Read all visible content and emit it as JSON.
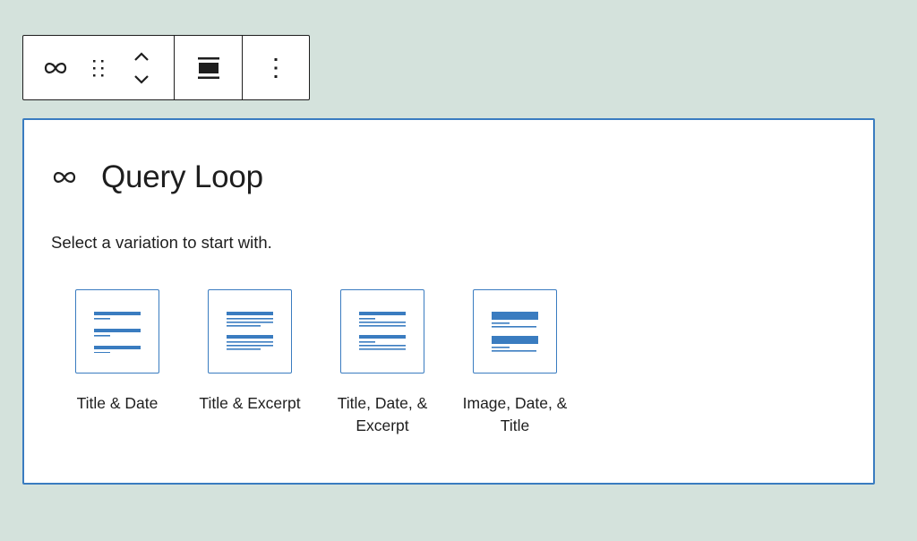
{
  "toolbar": {
    "groups": [
      {
        "buttons": [
          "query-loop-icon",
          "drag-handle-icon",
          "move-up-down-icon"
        ]
      },
      {
        "buttons": [
          "align-wide-icon"
        ]
      },
      {
        "buttons": [
          "more-options-icon"
        ]
      }
    ]
  },
  "placeholder": {
    "icon": "query-loop-icon",
    "title": "Query Loop",
    "instructions": "Select a variation to start with.",
    "variations": [
      {
        "label": "Title & Date",
        "icon": "title-date-pattern-icon"
      },
      {
        "label": "Title & Excerpt",
        "icon": "title-excerpt-pattern-icon"
      },
      {
        "label": "Title, Date, & Excerpt",
        "icon": "title-date-excerpt-pattern-icon"
      },
      {
        "label": "Image, Date, & Title",
        "icon": "image-date-title-pattern-icon"
      }
    ]
  },
  "colors": {
    "accent": "#3a7cc0",
    "background": "#d4e2dc",
    "text": "#1e1e1e"
  }
}
